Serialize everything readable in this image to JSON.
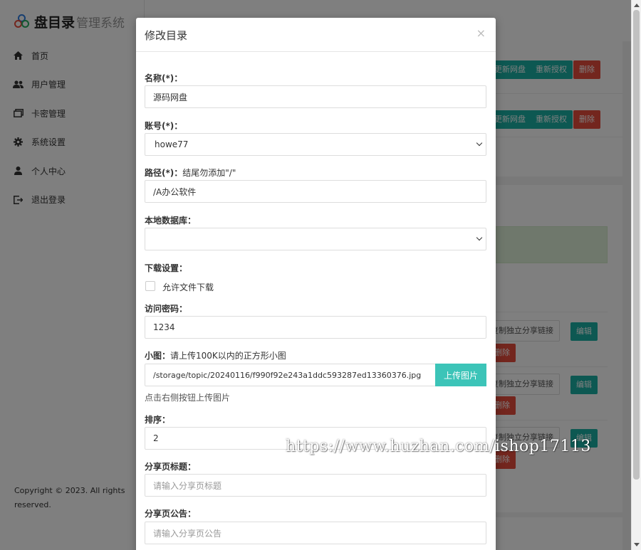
{
  "app": {
    "logo_text": "盘目录",
    "logo_sub": "管理系统"
  },
  "sidebar": {
    "items": [
      {
        "label": "首页",
        "icon": "home-icon"
      },
      {
        "label": "用户管理",
        "icon": "users-icon"
      },
      {
        "label": "卡密管理",
        "icon": "cards-icon"
      },
      {
        "label": "系统设置",
        "icon": "gear-icon"
      },
      {
        "label": "个人中心",
        "icon": "user-icon"
      },
      {
        "label": "退出登录",
        "icon": "logout-icon"
      }
    ],
    "copyright": "Copyright © 2023. All rights reserved."
  },
  "background": {
    "row_buttons": {
      "refresh_disk": "更新网盘",
      "reauthorize": "重新授权",
      "delete": "删除",
      "copy_share_link": "复制独立分享链接",
      "edit": "编辑"
    }
  },
  "modal": {
    "title": "修改目录",
    "close_glyph": "×",
    "name_label": "名称(*)：",
    "name_value": "源码网盘",
    "account_label": "账号(*)：",
    "account_value": "howe77",
    "path_label": "路径(*)：",
    "path_hint": "结尾勿添加\"/\"",
    "path_value": "/A办公软件",
    "localdb_label": "本地数据库：",
    "localdb_value": "",
    "download_label": "下载设置：",
    "allow_download_label": "允许文件下载",
    "allow_download_checked": false,
    "password_label": "访问密码：",
    "password_value": "1234",
    "thumb_label": "小图：",
    "thumb_hint": "请上传100K以内的正方形小图",
    "thumb_value": "/storage/topic/20240116/f990f92e243a1ddc593287ed13360376.jpg",
    "upload_button": "上传图片",
    "upload_help": "点击右侧按钮上传图片",
    "sort_label": "排序：",
    "sort_value": "2",
    "share_title_label": "分享页标题：",
    "share_title_placeholder": "请输入分享页标题",
    "share_notice_label": "分享页公告：",
    "share_notice_placeholder": "请输入分享页公告"
  },
  "watermark": "https://www.huzhan.com/ishop17113",
  "colors": {
    "accent": "#3cc4b8",
    "teal_button": "#1bb1a5",
    "danger": "#e74c3c"
  }
}
